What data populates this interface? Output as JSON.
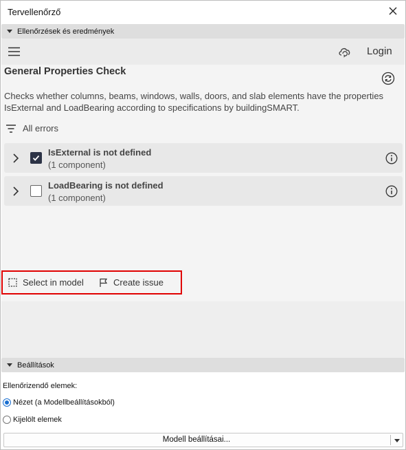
{
  "window": {
    "title": "Tervellenőrző"
  },
  "section1": {
    "label": "Ellenőrzések és eredmények"
  },
  "topbar": {
    "login_label": "Login"
  },
  "check": {
    "title": "General Properties Check",
    "description": "Checks whether columns, beams, windows, walls, doors, and slab elements have the properties IsExternal and LoadBearing according to specifications by buildingSMART."
  },
  "filter": {
    "label": "All errors"
  },
  "results": [
    {
      "name": "IsExternal is not defined",
      "count": "(1 component)",
      "checked": true
    },
    {
      "name": "LoadBearing is not defined",
      "count": "(1 component)",
      "checked": false
    }
  ],
  "actions": {
    "select_label": "Select in model",
    "issue_label": "Create issue"
  },
  "section2": {
    "label": "Beállítások"
  },
  "settings": {
    "elements_label": "Ellenőrizendő elemek:",
    "options": [
      {
        "label": "Nézet (a Modellbeállításokból)",
        "selected": true
      },
      {
        "label": "Kijelölt elemek",
        "selected": false
      }
    ],
    "model_settings_button": "Modell beállításai..."
  },
  "colors": {
    "highlight": "#e00000",
    "checkbox": "#2c3346",
    "radio": "#1a6fd0"
  }
}
